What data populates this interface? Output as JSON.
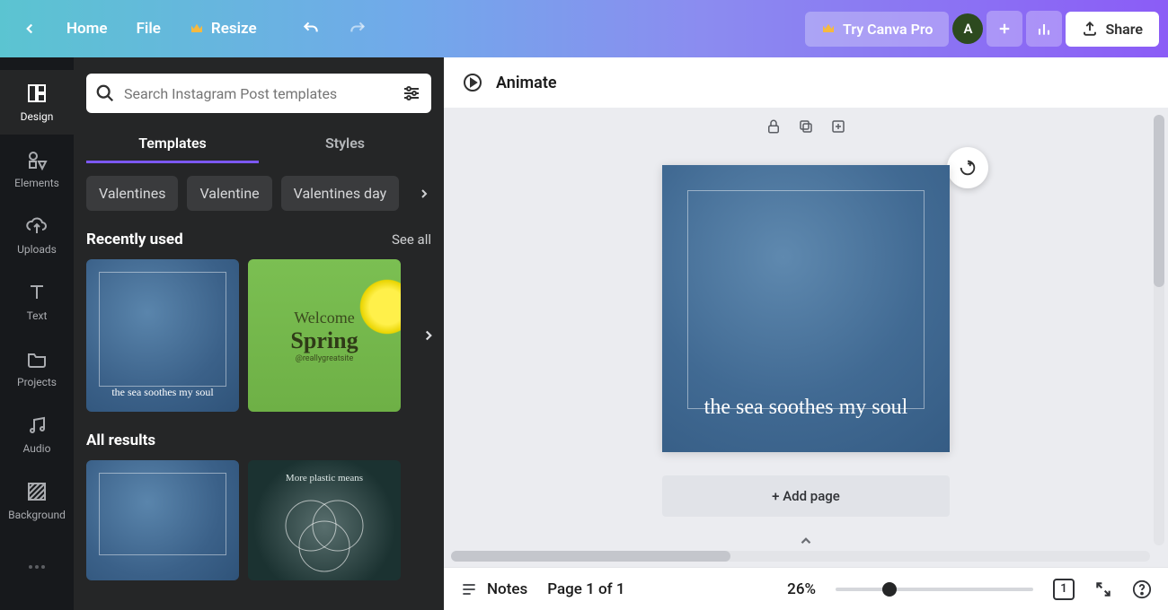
{
  "topbar": {
    "home": "Home",
    "file": "File",
    "resize": "Resize",
    "try_pro": "Try Canva Pro",
    "avatar_initial": "A",
    "share": "Share"
  },
  "rail": {
    "design": "Design",
    "elements": "Elements",
    "uploads": "Uploads",
    "text": "Text",
    "projects": "Projects",
    "audio": "Audio",
    "background": "Background"
  },
  "panel": {
    "search_placeholder": "Search Instagram Post templates",
    "tab_templates": "Templates",
    "tab_styles": "Styles",
    "chips": [
      "Valentines",
      "Valentine",
      "Valentines day"
    ],
    "recently_used": "Recently used",
    "see_all": "See all",
    "all_results": "All results",
    "thumb_sea_caption": "the sea soothes my soul",
    "thumb_green_line1": "Welcome",
    "thumb_green_line2": "Spring",
    "thumb_green_line3": "@reallygreatsite",
    "thumb_dark_caption": "More plastic means"
  },
  "editor": {
    "animate": "Animate",
    "page_text": "the sea soothes my soul",
    "add_page": "+ Add page"
  },
  "footer": {
    "notes": "Notes",
    "page_indicator": "Page 1 of 1",
    "zoom": "26%",
    "page_badge": "1"
  }
}
